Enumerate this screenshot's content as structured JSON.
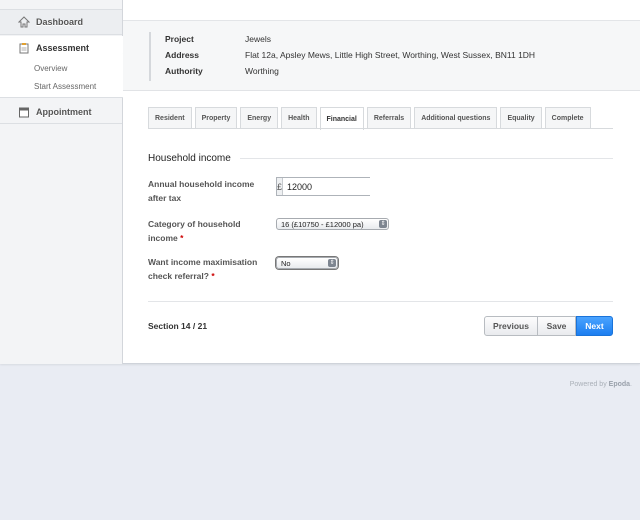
{
  "sidebar": {
    "dashboard": "Dashboard",
    "assessment": "Assessment",
    "overview": "Overview",
    "start_assessment": "Start Assessment",
    "appointment": "Appointment"
  },
  "info": {
    "project_label": "Project",
    "project_value": "Jewels",
    "address_label": "Address",
    "address_value": "Flat 12a, Apsley Mews, Little High Street, Worthing, West Sussex, BN11 1DH",
    "authority_label": "Authority",
    "authority_value": "Worthing"
  },
  "tabs": [
    {
      "label": "Resident"
    },
    {
      "label": "Property"
    },
    {
      "label": "Energy"
    },
    {
      "label": "Health"
    },
    {
      "label": "Financial"
    },
    {
      "label": "Referrals"
    },
    {
      "label": "Additional questions"
    },
    {
      "label": "Equality"
    },
    {
      "label": "Complete"
    }
  ],
  "section": {
    "title": "Household income",
    "income_label_1": "Annual household income",
    "income_label_2": "after tax",
    "currency_symbol": "£",
    "income_value": "12000",
    "category_label_1": "Category of household",
    "category_label_2": "income",
    "category_value": "16 (£10750 - £12000 pa)",
    "referral_label_1": "Want income maximisation",
    "referral_label_2": "check referral?",
    "referral_value": "No",
    "required_mark": "*"
  },
  "footer": {
    "section_count": "Section 14 / 21",
    "previous": "Previous",
    "save": "Save",
    "next": "Next",
    "powered_prefix": "Powered by",
    "powered_brand": "Epoda"
  },
  "colors": {
    "accent": "#1c7ef0",
    "required": "#cc0000"
  }
}
